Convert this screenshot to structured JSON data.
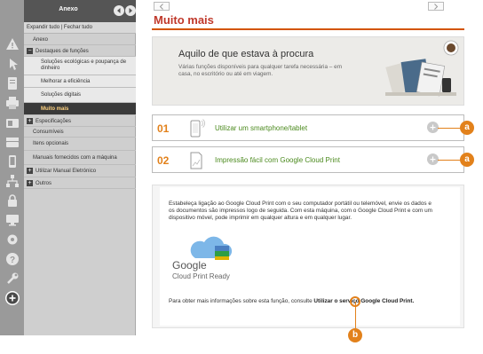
{
  "sidebar": {
    "title": "Anexo",
    "toolbar_label": "Expandir tudo | Fechar tudo",
    "items": [
      {
        "label": "Anexo",
        "kind": "top"
      },
      {
        "label": "Destaques de funções",
        "kind": "section",
        "expander": "−"
      },
      {
        "label": "Soluções ecológicas e poupança de dinheiro",
        "kind": "sub"
      },
      {
        "label": "Melhorar a eficiência",
        "kind": "sub"
      },
      {
        "label": "Soluções digitais",
        "kind": "sub"
      },
      {
        "label": "Muito mais",
        "kind": "active"
      },
      {
        "label": "Especificações",
        "kind": "section",
        "expander": "+"
      },
      {
        "label": "Consumíveis",
        "kind": "top"
      },
      {
        "label": "Itens opcionais",
        "kind": "top"
      },
      {
        "label": "Manuais fornecidos com a máquina",
        "kind": "top"
      },
      {
        "label": "Utilizar Manual Eletrónico",
        "kind": "section",
        "expander": "+"
      },
      {
        "label": "Outros",
        "kind": "section",
        "expander": "+"
      }
    ],
    "rail_icons": [
      "warning-icon",
      "pointer-icon",
      "document-icon",
      "printer-icon",
      "fax-icon",
      "scanner-icon",
      "phone-icon",
      "network-icon",
      "lock-icon",
      "monitor-icon",
      "gear-icon",
      "help-icon",
      "wrench-icon",
      "plus-circle-icon"
    ]
  },
  "main": {
    "title": "Muito mais",
    "banner": {
      "heading": "Aquilo de que estava à procura",
      "text": "Várias funções disponíveis para qualquer tarefa necessária – em casa, no escritório ou até em viagem."
    },
    "features": [
      {
        "number": "01",
        "label": "Utilizar um smartphone/tablet",
        "icon": "smartphone-icon",
        "marker": "a"
      },
      {
        "number": "02",
        "label": "Impressão fácil com Google Cloud Print",
        "icon": "document-icon",
        "marker": "a"
      }
    ],
    "detail": {
      "paragraph": "Estabeleça ligação ao Google Cloud Print com o seu computador portátil ou telemóvel, envie os dados e os documentos são impressos logo de seguida. Com esta máquina, com o Google Cloud Print e com um dispositivo móvel, pode imprimir em qualquer altura e em qualquer lugar.",
      "logo_google": "Google",
      "logo_sub": "Cloud Print Ready",
      "more_prefix": "Para obter mais informações sobre esta função, consulte",
      "more_link": "Utilizar o serviço Google Cloud Print.",
      "marker": "b"
    }
  },
  "colors": {
    "accent": "#e2811b",
    "title": "#c0392b",
    "link_green": "#4b8a1e",
    "sidebar_active": "#3a3a3a"
  }
}
